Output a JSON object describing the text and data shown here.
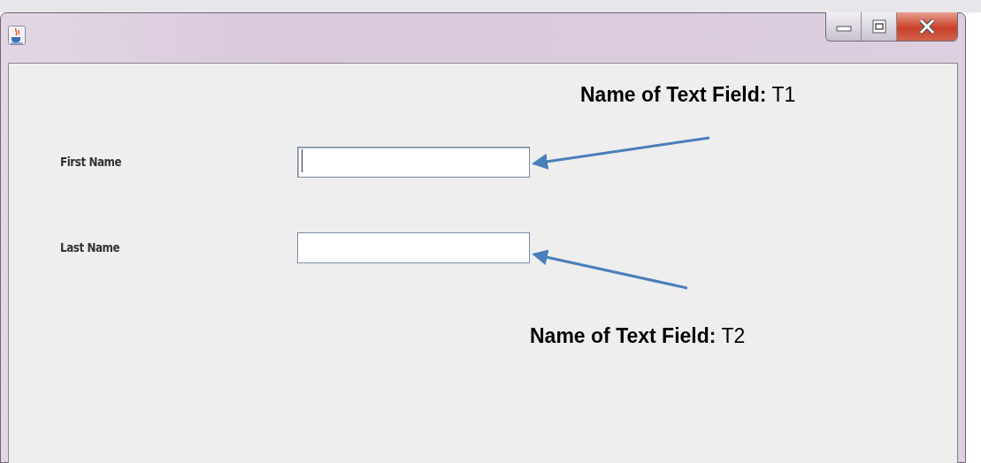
{
  "form": {
    "fields": [
      {
        "label": "First Name",
        "focused": true
      },
      {
        "label": "Last Name",
        "focused": false
      }
    ]
  },
  "annotations": [
    {
      "text": "**Name of Text Field:** T1"
    },
    {
      "text": "**Name of Text Field:** T2"
    }
  ]
}
